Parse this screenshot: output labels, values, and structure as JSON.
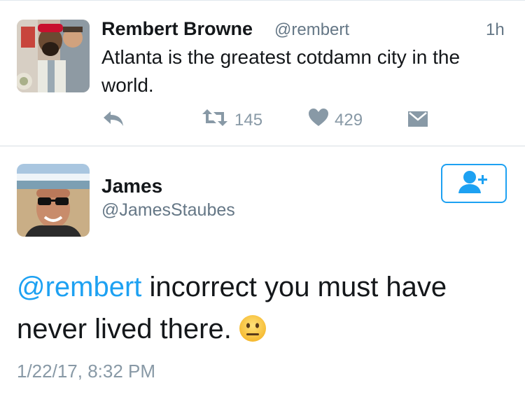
{
  "tweet": {
    "author_name": "Rembert Browne",
    "author_handle": "@rembert",
    "time_ago": "1h",
    "text": "Atlanta is the greatest cotdamn city in the world.",
    "actions": {
      "reply_icon": "reply-icon",
      "retweet_icon": "retweet-icon",
      "retweet_count": "145",
      "like_icon": "heart-icon",
      "like_count": "429",
      "dm_icon": "envelope-icon"
    }
  },
  "reply": {
    "author_name": "James",
    "author_handle": "@JamesStaubes",
    "follow_icon": "add-user-icon",
    "mention": "@rembert",
    "text": " incorrect you must have never lived there.",
    "emoji": "neutral-face-emoji",
    "timestamp": "1/22/17, 8:32 PM"
  },
  "colors": {
    "accent": "#1da1f2",
    "secondary_text": "#657786",
    "icon_gray": "#8899a6",
    "divider": "#d8dee3"
  }
}
